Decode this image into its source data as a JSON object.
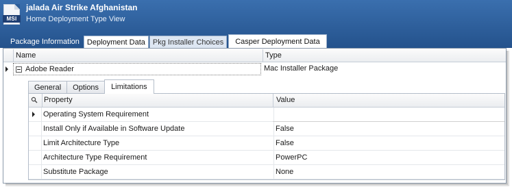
{
  "header": {
    "title": "jalada Air Strike Afghanistan",
    "subtitle": "Home Deployment Type View",
    "icon_label": "MSI"
  },
  "top_tabs": [
    {
      "label": "Package Information"
    },
    {
      "label": "Deployment Data"
    },
    {
      "label": "Pkg Installer Choices",
      "selected": true
    },
    {
      "label": "Casper Deployment Data"
    }
  ],
  "package_grid": {
    "columns": [
      "Name",
      "Type"
    ],
    "rows": [
      {
        "name": "Adobe Reader",
        "type": "Mac Installer Package",
        "expanded": true
      }
    ]
  },
  "sub_tabs": [
    {
      "label": "General"
    },
    {
      "label": "Options"
    },
    {
      "label": "Limitations",
      "active": true
    }
  ],
  "property_grid": {
    "columns": [
      "Property",
      "Value"
    ],
    "rows": [
      {
        "property": "Operating System Requirement",
        "value": ""
      },
      {
        "property": "Install Only if Available in Software Update",
        "value": "False"
      },
      {
        "property": "Limit Architecture Type",
        "value": "False"
      },
      {
        "property": "Architecture Type Requirement",
        "value": "PowerPC"
      },
      {
        "property": "Substitute Package",
        "value": "None"
      }
    ]
  },
  "colors": {
    "header_bg": "#2b5d99",
    "selected_tab_bg": "#dde6f2"
  }
}
